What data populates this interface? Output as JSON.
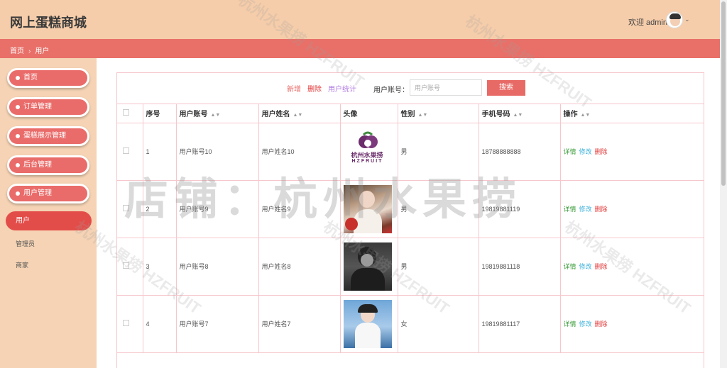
{
  "header": {
    "title": "网上蛋糕商城",
    "welcome": "欢迎 admin"
  },
  "breadcrumb": [
    "首页",
    "用户"
  ],
  "sidebar": {
    "menus": [
      "首页",
      "订单管理",
      "蛋糕展示管理",
      "后台管理",
      "用户管理"
    ],
    "subitems": [
      "用户",
      "管理员",
      "商家"
    ]
  },
  "toolbar": {
    "add": "新增",
    "delete": "删除",
    "stats": "用户统计",
    "search_label": "用户账号：",
    "search_placeholder": "用户账号",
    "search_button": "搜索"
  },
  "table": {
    "headers": [
      "序号",
      "用户账号",
      "用户姓名",
      "头像",
      "性别",
      "手机号码",
      "操作"
    ],
    "actions": {
      "detail": "详情",
      "edit": "修改",
      "delete": "删除"
    },
    "rows": [
      {
        "no": "1",
        "account": "用户账号10",
        "name": "用户姓名10",
        "avatar": "logo",
        "gender": "男",
        "phone": "18788888888"
      },
      {
        "no": "2",
        "account": "用户账号9",
        "name": "用户姓名9",
        "avatar": "photo-woman-flowers",
        "gender": "男",
        "phone": "19819881119"
      },
      {
        "no": "3",
        "account": "用户账号8",
        "name": "用户姓名8",
        "avatar": "photo-man-bw",
        "gender": "男",
        "phone": "19819881118"
      },
      {
        "no": "4",
        "account": "用户账号7",
        "name": "用户姓名7",
        "avatar": "photo-woman-sky",
        "gender": "女",
        "phone": "19819881117"
      }
    ]
  },
  "logo_text": {
    "cn": "杭州水果捞",
    "en": "HZFRUIT"
  },
  "watermark": {
    "main": "店铺：杭州水果捞",
    "small": "杭州水果捞 HZFRUIT"
  },
  "colors": {
    "accent": "#e86a66",
    "header_bg": "#f6cdaa",
    "sidebar_bg": "#f5d3b4",
    "detail": "#3a9b3a",
    "edit": "#3bb0d9",
    "delete": "#e23b3b",
    "stats": "#b07be0"
  }
}
